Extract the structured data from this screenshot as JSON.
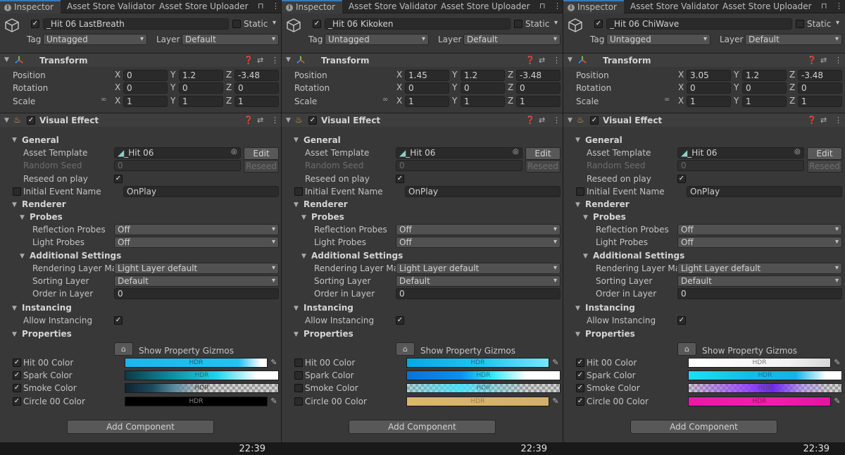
{
  "tabs": [
    "Inspector",
    "Asset Store Validator",
    "Asset Store Uploader"
  ],
  "labels": {
    "static": "Static",
    "tag": "Tag",
    "layer": "Layer",
    "transform": "Transform",
    "position": "Position",
    "rotation": "Rotation",
    "scale": "Scale",
    "x": "X",
    "y": "Y",
    "z": "Z",
    "visual_effect": "Visual Effect",
    "general": "General",
    "asset_template": "Asset Template",
    "random_seed": "Random Seed",
    "reseed_on_play": "Reseed on play",
    "initial_event_name": "Initial Event Name",
    "edit": "Edit",
    "reseed": "Reseed",
    "renderer": "Renderer",
    "probes": "Probes",
    "reflection_probes": "Reflection Probes",
    "light_probes": "Light Probes",
    "additional_settings": "Additional Settings",
    "rendering_layer_mask": "Rendering Layer Mas",
    "sorting_layer": "Sorting Layer",
    "order_in_layer": "Order in Layer",
    "instancing": "Instancing",
    "allow_instancing": "Allow Instancing",
    "properties": "Properties",
    "show_gizmos": "Show Property Gizmos",
    "hit_color": "Hit 00 Color",
    "spark_color": "Spark Color",
    "smoke_color": "Smoke Color",
    "circle_color": "Circle 00 Color",
    "hdr": "HDR",
    "add_component": "Add Component"
  },
  "panels": [
    {
      "name": "_Hit 06 LastBreath",
      "tag": "Untagged",
      "layer": "Default",
      "position": {
        "x": "0",
        "y": "1.2",
        "z": "-3.48"
      },
      "rotation": {
        "x": "0",
        "y": "0",
        "z": "0"
      },
      "scale": {
        "x": "1",
        "y": "1",
        "z": "1"
      },
      "asset_template": "_Hit 06",
      "random_seed": "0",
      "initial_event": "OnPlay",
      "reflection_probes": "Off",
      "light_probes": "Off",
      "rendering_layer": "Light Layer default",
      "sorting_layer": "Default",
      "order_in_layer": "0",
      "prop_checked": [
        true,
        true,
        true,
        true
      ],
      "colors": {
        "hit": "linear-gradient(90deg,#1bb6ee 0%,#22c2f5 80%,#ffffff 96%)",
        "spark": "linear-gradient(90deg,#0c3a44 0%,#0e7e93 25%,#1fd7ea 60%,#ffffff 86%,#ffffff 100%)",
        "smoke": "linear-gradient(90deg,#0e2430 0%,#1e4a5e 18%,#5a8aa0 32%,rgba(150,150,150,0.0) 50%),repeating-conic-gradient(#9a9a9a 0% 25%, #cfcfcf 0% 50%) 0 0/8px 8px",
        "circle": "#000000"
      },
      "hdr_colors": {
        "hit": "#1b5d78",
        "spark": "#1e6e7c",
        "smoke": "#3d3d3d",
        "circle": "#8a8a8a"
      }
    },
    {
      "name": "_Hit 06 Kikoken",
      "tag": "Untagged",
      "layer": "Default",
      "position": {
        "x": "1.45",
        "y": "1.2",
        "z": "-3.48"
      },
      "rotation": {
        "x": "0",
        "y": "0",
        "z": "0"
      },
      "scale": {
        "x": "1",
        "y": "1",
        "z": "1"
      },
      "asset_template": "_Hit 06",
      "random_seed": "0",
      "initial_event": "OnPlay",
      "reflection_probes": "Off",
      "light_probes": "Off",
      "rendering_layer": "Light Layer default",
      "sorting_layer": "Default",
      "order_in_layer": "0",
      "prop_checked": [
        false,
        false,
        false,
        false
      ],
      "colors": {
        "hit": "linear-gradient(90deg,#05a8e6 0%,#1fc7f4 55%,#6fe7ff 97%)",
        "spark": "linear-gradient(90deg,#0b72d6 0%,#0b8ff0 35%,#27eaf6 55%,#ffffff 78%,#ffffff 100%)",
        "smoke": "linear-gradient(90deg,rgba(60,220,255,0.2) 0%,rgba(60,230,255,0.85) 35%,rgba(60,230,255,0.3) 60%,rgba(255,255,255,0) 80%),repeating-conic-gradient(#9a9a9a 0% 25%, #cfcfcf 0% 50%) 0 0/8px 8px",
        "circle": "linear-gradient(90deg,#d9b86a 0%,#d3b06a 100%)"
      },
      "hdr_colors": {
        "hit": "#1c6f8e",
        "spark": "#2a6e8a",
        "smoke": "#4a6a7a",
        "circle": "#9a7f45"
      }
    },
    {
      "name": "_Hit 06 ChiWave",
      "tag": "Untagged",
      "layer": "Default",
      "position": {
        "x": "3.05",
        "y": "1.2",
        "z": "-3.48"
      },
      "rotation": {
        "x": "0",
        "y": "0",
        "z": "0"
      },
      "scale": {
        "x": "1",
        "y": "1",
        "z": "1"
      },
      "asset_template": "_Hit 06",
      "random_seed": "0",
      "initial_event": "OnPlay",
      "reflection_probes": "Off",
      "light_probes": "Off",
      "rendering_layer": "Light Layer default",
      "sorting_layer": "Default",
      "order_in_layer": "0",
      "prop_checked": [
        true,
        true,
        true,
        true
      ],
      "colors": {
        "hit": "linear-gradient(90deg,#ffffff 0%,#f2f2f2 70%,#d8d8d8 100%)",
        "spark": "linear-gradient(90deg,#1be0ee 0%,#14bde6 40%,#14b4e4 70%,#ffffff 90%)",
        "smoke": "linear-gradient(90deg,rgba(200,120,255,0.1) 0%,rgba(150,60,255,0.8) 35%,rgba(110,40,240,1) 55%,rgba(170,120,255,0.5) 75%,rgba(255,255,255,0) 92%),repeating-conic-gradient(#9a9a9a 0% 25%, #cfcfcf 0% 50%) 0 0/8px 8px",
        "circle": "linear-gradient(90deg,#e81aa6 0%,#f21db0 60%,#e015a0 100%)"
      },
      "hdr_colors": {
        "hit": "#7a7a7a",
        "spark": "#1c6f8e",
        "smoke": "#4a4a6a",
        "circle": "#8e1066"
      }
    }
  ],
  "time": "22:39"
}
